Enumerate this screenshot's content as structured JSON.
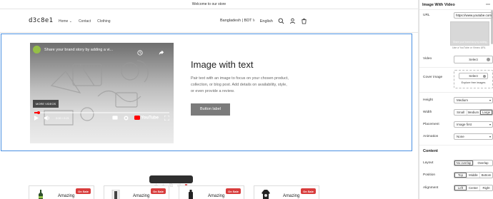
{
  "announcement": "Welcome to our store",
  "logo": "d3c8e1",
  "nav": [
    {
      "label": "Home"
    },
    {
      "label": "Contact"
    },
    {
      "label": "Clothing"
    }
  ],
  "nav_home_chevron": "⌄",
  "header_util": {
    "currency": "Bangladesh | BDT ৳",
    "language": "English"
  },
  "video": {
    "title": "Share your brand story by adding a vi...",
    "more_videos": "MORE VIDEOS",
    "time": "0:00 / 0:21",
    "brand": "YouTube",
    "progress": 0.03
  },
  "content": {
    "heading": "Image with text",
    "body": "Pair text with an image to focus on your chosen product, collection, or blog post. Add details on availability, style, or even provide a review.",
    "button": "Button label"
  },
  "products": [
    {
      "name": "Amazing",
      "badge": "On Sale"
    },
    {
      "name": "Amazing",
      "badge": "On Sale"
    },
    {
      "name": "Amazing",
      "badge": "On Sale"
    },
    {
      "name": "Amazing",
      "badge": "On Sale"
    }
  ],
  "panel": {
    "title": "Image With Video",
    "url_label": "URL",
    "url_value": "https://www.youtube.com",
    "thumb_caption": "Share your brand story by adding...",
    "url_hint": "Use a YouTube or Vimeo URL",
    "video_label": "Video",
    "video_button": "Select",
    "cover_label": "Cover image",
    "cover_button": "Select",
    "cover_link": "Explore free images",
    "height_label": "Height",
    "height_value": "Medium",
    "width_label": "Width",
    "width_options": [
      "Small",
      "Medium",
      "Large"
    ],
    "width_selected": 2,
    "placement_label": "Placement",
    "placement_value": "Image first",
    "animation_label": "Animation",
    "animation_value": "None",
    "content_heading": "Content",
    "layout_label": "Layout",
    "layout_options": [
      "No overlap",
      "Overlap"
    ],
    "layout_selected": 0,
    "position_label": "Position",
    "position_options": [
      "Top",
      "Middle",
      "Bottom"
    ],
    "position_selected": 0,
    "alignment_label": "Alignment",
    "alignment_options": [
      "Left",
      "Center",
      "Right"
    ],
    "alignment_selected": 0
  },
  "colors": {
    "selection_outline": "#4a90e2",
    "sale_badge": "#d83c3c",
    "primary_button": "#7b7b7b",
    "youtube_red": "#ff0000"
  }
}
